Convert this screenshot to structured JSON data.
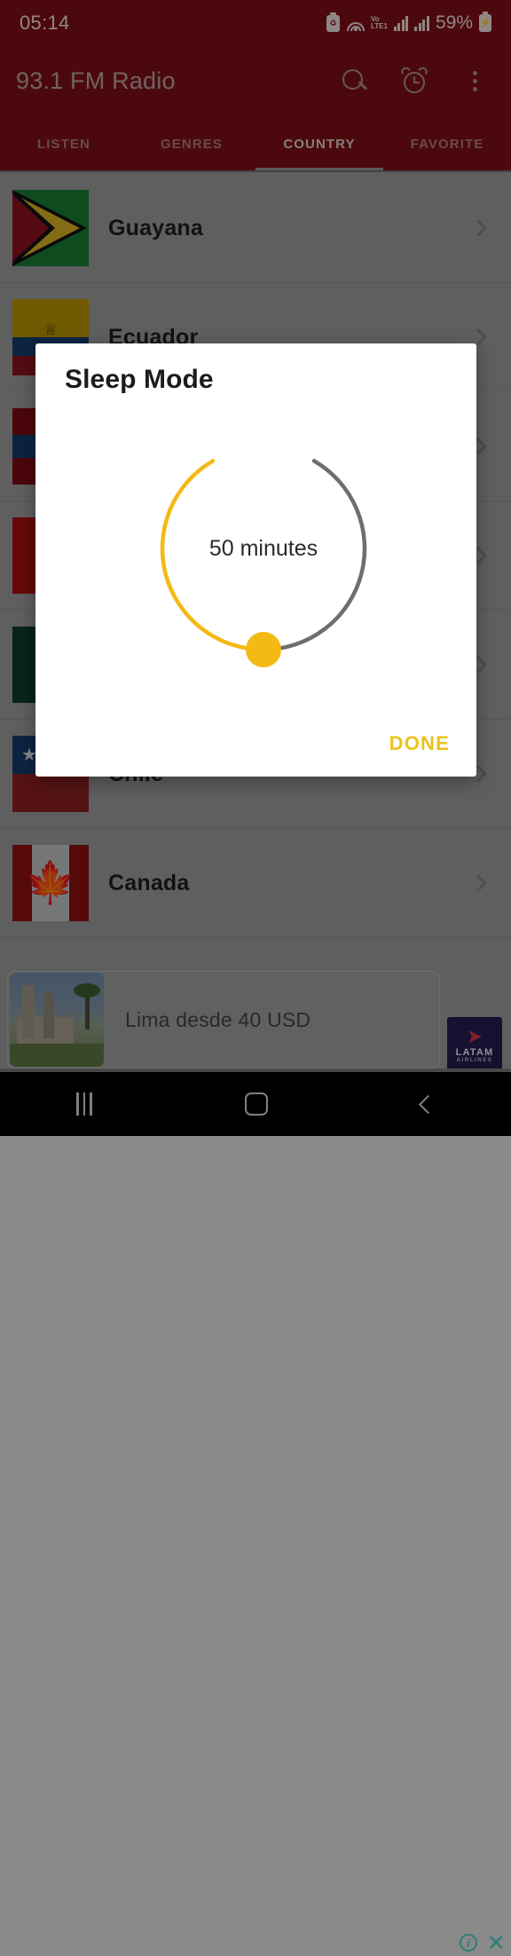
{
  "status_bar": {
    "clock": "05:14",
    "battery_percent": "59%",
    "network_label": "LTE1",
    "volte_label": "Vo",
    "icons": [
      "battery-saver-icon",
      "wifi-icon",
      "volte-icon",
      "signal-bars-icon",
      "signal-bars-2-icon",
      "charging-battery-icon"
    ]
  },
  "app_bar": {
    "title": "93.1 FM Radio",
    "actions": [
      "search-icon",
      "alarm-icon",
      "overflow-menu-icon"
    ]
  },
  "tabs": [
    {
      "label": "LISTEN",
      "active": false
    },
    {
      "label": "GENRES",
      "active": false
    },
    {
      "label": "COUNTRY",
      "active": true
    },
    {
      "label": "FAVORITE",
      "active": false
    }
  ],
  "country_list": [
    {
      "name": "Guayana",
      "flag": "guyana"
    },
    {
      "name": "Ecuador",
      "flag": "ecuador"
    },
    {
      "name": "",
      "flag": "redblue"
    },
    {
      "name": "",
      "flag": "red"
    },
    {
      "name": "",
      "flag": "green"
    },
    {
      "name": "Chile",
      "flag": "chile"
    },
    {
      "name": "Canada",
      "flag": "canada"
    }
  ],
  "dialog": {
    "title": "Sleep Mode",
    "value_text": "50 minutes",
    "minutes": 50,
    "max_minutes": 120,
    "done_label": "DONE",
    "accent_color": "#F5B914",
    "track_color": "#6E6E6E",
    "sweep_degrees": 150,
    "total_sweep_degrees": 300
  },
  "ad": {
    "headline": "Lima desde 40 USD",
    "advertiser_name": "LATAM",
    "advertiser_sub": "AIRLINES",
    "info_icon": "ad-info-icon",
    "close_icon": "ad-close-icon"
  },
  "nav_bar": {
    "recents_label": "recents-icon",
    "home_label": "home-icon",
    "back_label": "back-icon"
  }
}
